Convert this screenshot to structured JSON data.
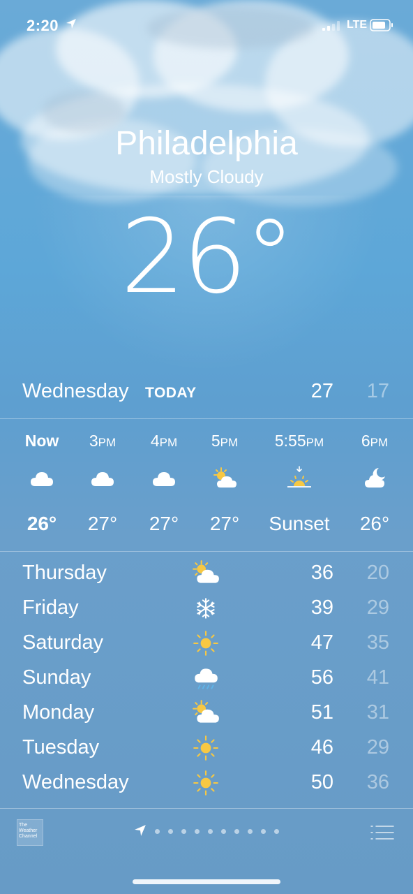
{
  "status_bar": {
    "time": "2:20",
    "network": "LTE"
  },
  "header": {
    "city": "Philadelphia",
    "condition": "Mostly Cloudy",
    "temperature": "26°"
  },
  "today": {
    "day": "Wednesday",
    "tag": "TODAY",
    "high": "27",
    "low": "17"
  },
  "hourly": [
    {
      "label": "Now",
      "icon": "cloud-icon",
      "temp": "26°"
    },
    {
      "label": "3PM",
      "icon": "cloud-icon",
      "temp": "27°"
    },
    {
      "label": "4PM",
      "icon": "cloud-icon",
      "temp": "27°"
    },
    {
      "label": "5PM",
      "icon": "partly-sunny-icon",
      "temp": "27°"
    },
    {
      "label": "5:55PM",
      "icon": "sunset-icon",
      "temp": "Sunset"
    },
    {
      "label": "6PM",
      "icon": "partly-cloudy-night-icon",
      "temp": "26°"
    }
  ],
  "daily": [
    {
      "day": "Thursday",
      "icon": "partly-sunny-icon",
      "high": "36",
      "low": "20"
    },
    {
      "day": "Friday",
      "icon": "snow-icon",
      "high": "39",
      "low": "29"
    },
    {
      "day": "Saturday",
      "icon": "sun-icon",
      "high": "47",
      "low": "35"
    },
    {
      "day": "Sunday",
      "icon": "rain-icon",
      "high": "56",
      "low": "41"
    },
    {
      "day": "Monday",
      "icon": "partly-sunny-icon",
      "high": "51",
      "low": "31"
    },
    {
      "day": "Tuesday",
      "icon": "sun-icon",
      "high": "46",
      "low": "29"
    },
    {
      "day": "Wednesday",
      "icon": "sun-icon",
      "high": "50",
      "low": "36"
    }
  ],
  "footer": {
    "logo_text": "The Weather Channel",
    "page_count": 10
  },
  "colors": {
    "sun": "#f7c843",
    "text": "#ffffff",
    "muted_low": "rgba(255,255,255,0.45)"
  }
}
